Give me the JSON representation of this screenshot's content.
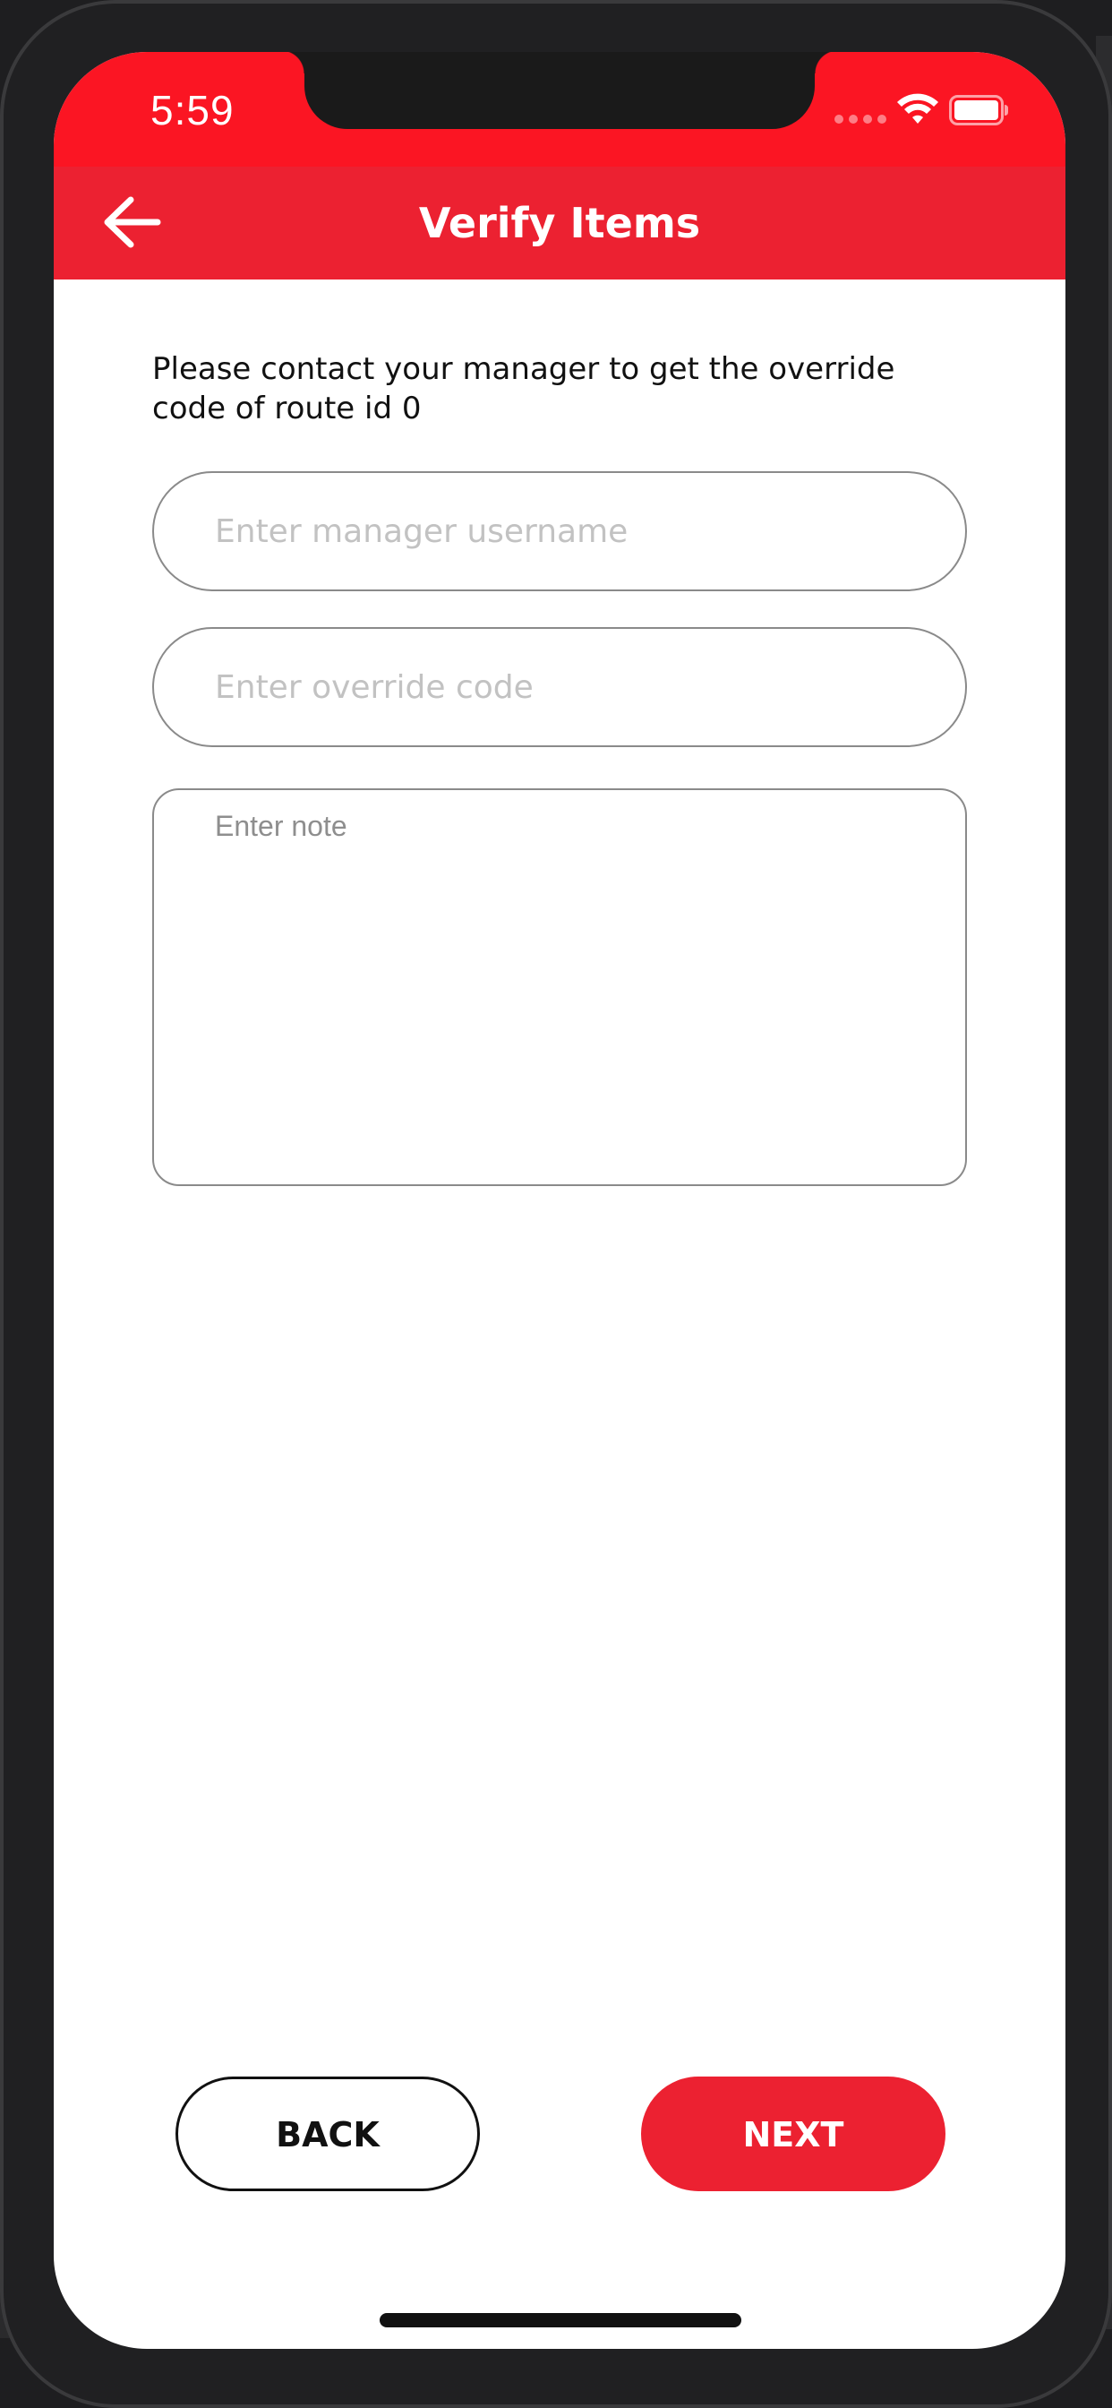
{
  "status_bar": {
    "time": "5:59",
    "bg_color": "#fb1523",
    "icons": [
      "signal-dots-icon",
      "wifi-icon",
      "battery-icon"
    ]
  },
  "nav": {
    "title": "Verify Items",
    "back_icon": "arrow-left-icon",
    "bg_color": "#ec2131"
  },
  "form": {
    "instruction": "Please contact your manager to get the override code of route id 0",
    "username_placeholder": "Enter manager username",
    "username_value": "",
    "code_placeholder": "Enter override code",
    "code_value": "",
    "note_placeholder": "Enter note",
    "note_value": ""
  },
  "actions": {
    "back_label": "BACK",
    "next_label": "NEXT",
    "accent_color": "#ec2131"
  }
}
